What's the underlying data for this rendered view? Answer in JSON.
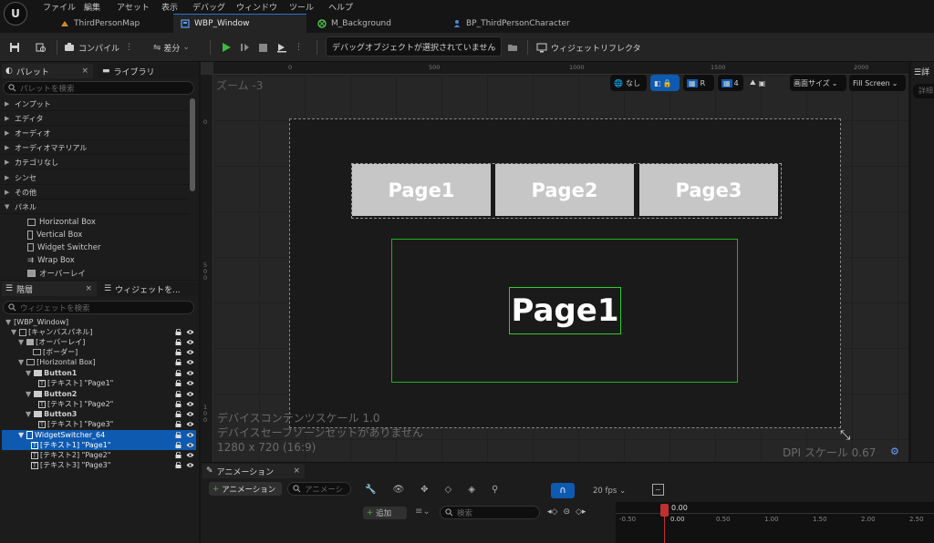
{
  "menubar": {
    "logo": "U",
    "items": [
      "ファイル",
      "編集",
      "アセット",
      "表示",
      "デバッグ",
      "ウィンドウ",
      "ツール",
      "ヘルプ"
    ]
  },
  "tabs": [
    {
      "label": "ThirdPersonMap",
      "icon": "level-icon",
      "active": false
    },
    {
      "label": "WBP_Window",
      "icon": "widget-blueprint-icon",
      "active": true
    },
    {
      "label": "M_Background",
      "icon": "material-icon",
      "active": false
    },
    {
      "label": "BP_ThirdPersonCharacter",
      "icon": "character-icon",
      "active": false
    }
  ],
  "toolbar": {
    "compile": "コンパイル",
    "diff": "差分",
    "debug_object": "デバッグオブジェクトが選択されていません",
    "widget_reflector": "ウィジェットリフレクタ"
  },
  "palette": {
    "tab_label": "パレット",
    "library_tab": "ライブラリ",
    "search_placeholder": "パレットを検索",
    "categories": [
      "インプット",
      "エディタ",
      "オーディオ",
      "オーディオマテリアル",
      "カテゴリなし",
      "シンセ",
      "その他",
      "パネル"
    ],
    "items": [
      "Horizontal Box",
      "Vertical Box",
      "Widget Switcher",
      "Wrap Box",
      "オーバーレイ"
    ]
  },
  "hierarchy": {
    "tab_label": "階層",
    "widgets_tab": "ウィジェットを...",
    "search_placeholder": "ウィジェットを検索",
    "rows": [
      "[WBP_Window]",
      "[キャンバスパネル]",
      "[オーバーレイ]",
      "[ボーダー]",
      "[Horizontal Box]",
      "Button1",
      "[テキスト] \"Page1\"",
      "Button2",
      "[テキスト] \"Page2\"",
      "Button3",
      "[テキスト] \"Page3\"",
      "WidgetSwitcher_64",
      "[テキスト1] \"Page1\"",
      "[テキスト2] \"Page2\"",
      "[テキスト3] \"Page3\""
    ]
  },
  "designer": {
    "zoom": "ズーム -3",
    "ruler_top": [
      "0",
      "500",
      "1000",
      "1500",
      "2000"
    ],
    "ruler_left": [
      "0",
      "5\n0\n0",
      "1\n0\n0"
    ],
    "overlay": {
      "none": "なし",
      "r": "R",
      "grid_num": "4",
      "screen_size": "画面サイズ",
      "fill_screen": "Fill Screen"
    },
    "buttons": [
      "Page1",
      "Page2",
      "Page3"
    ],
    "switcher_text": "Page1",
    "info_line1": "デバイスコンテンツスケール 1.0",
    "info_line2": "デバイスセーフゾーンセットがありません",
    "info_line3": "1280 x 720 (16:9)",
    "dpi": "DPI スケール 0.67"
  },
  "animation": {
    "tab_label": "アニメーション",
    "add_anim": "アニメーション",
    "search_placeholder": "アニメーシ",
    "fps": "20 fps",
    "add": "追加",
    "search2": "検索",
    "playhead": "0.00",
    "timeline": [
      "-0.50",
      "0.00",
      "0.50",
      "1.00",
      "1.50",
      "2.00",
      "2.50"
    ]
  },
  "details": {
    "tab_label": "詳",
    "search_placeholder": "詳細"
  },
  "colors": {
    "accent_blue": "#0e5ab0",
    "play_green": "#3fb93f",
    "selection_green": "#1db21d",
    "button_grey": "#c6c6c6"
  }
}
